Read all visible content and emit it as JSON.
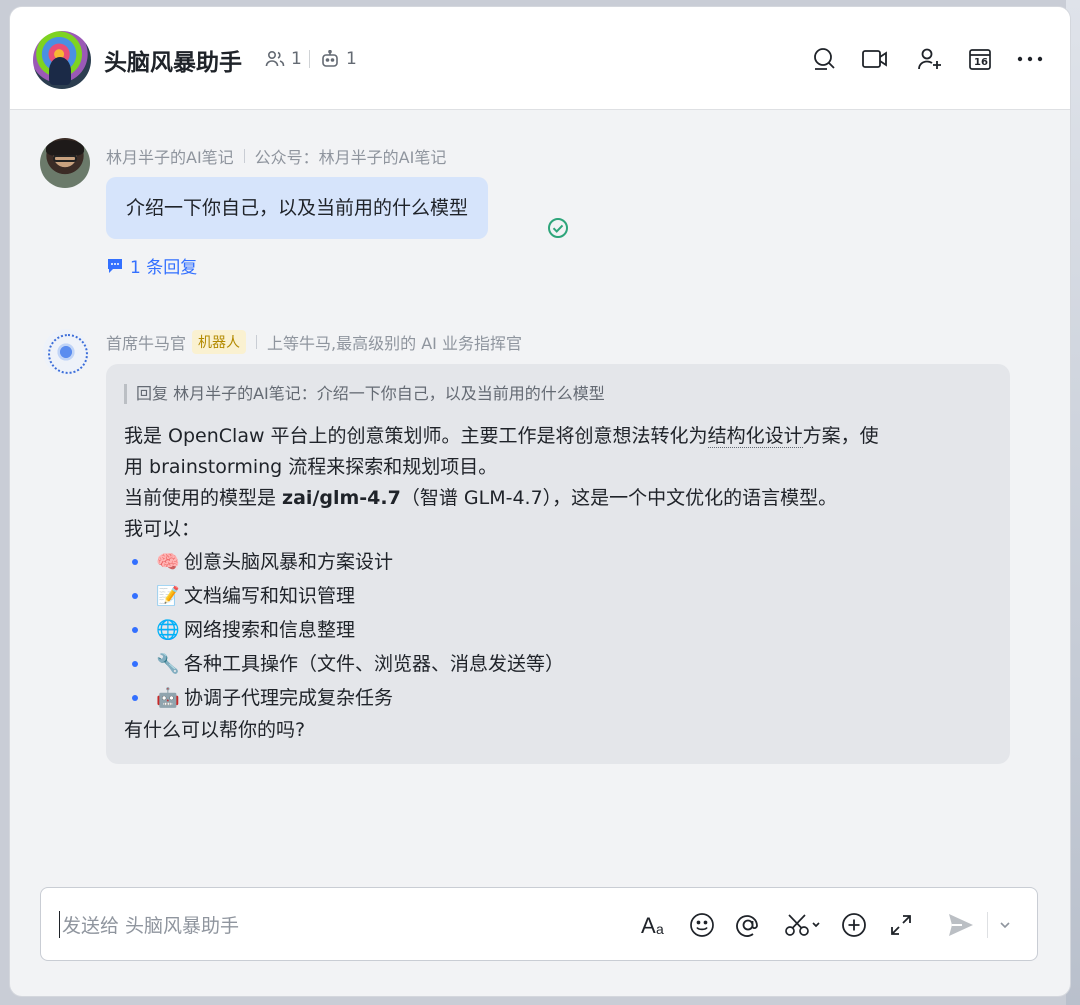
{
  "header": {
    "title": "头脑风暴助手",
    "member_count": "1",
    "bot_count": "1",
    "icons": [
      "search-icon",
      "video-call-icon",
      "add-member-icon",
      "calendar-icon",
      "more-icon"
    ],
    "calendar_day": "16"
  },
  "messages": {
    "user": {
      "name": "林月半子的AI笔记",
      "subtitle": "公众号：林月半子的AI笔记",
      "text": "介绍一下你自己，以及当前用的什么模型",
      "reply_count": "1 条回复"
    },
    "bot": {
      "name": "首席牛马官",
      "badge": "机器人",
      "subtitle": "上等牛马,最高级别的 AI 业务指挥官",
      "quote": "回复 林月半子的AI笔记：介绍一下你自己，以及当前用的什么模型",
      "line1a": "我是 OpenClaw 平台上的创意策划师。主要工作是将创意想法转化为",
      "line1b": "结构化设计",
      "line1c": "方案，使",
      "line2": "用 brainstorming 流程来探索和规划项目。",
      "line3a": "当前使用的模型是 ",
      "line3b": "zai/glm-4.7",
      "line3c": "（智谱 GLM-4.7），这是一个中文优化的语言模型。",
      "line4": "我可以：",
      "bullets": [
        {
          "emoji": "🧠",
          "text": "创意头脑风暴和方案设计"
        },
        {
          "emoji": "📝",
          "text": "文档编写和知识管理"
        },
        {
          "emoji": "🌐",
          "text": "网络搜索和信息整理"
        },
        {
          "emoji": "🔧",
          "text": "各种工具操作（文件、浏览器、消息发送等）"
        },
        {
          "emoji": "🤖",
          "text": "协调子代理完成复杂任务"
        }
      ],
      "closing": "有什么可以帮你的吗?"
    }
  },
  "composer": {
    "placeholder": "发送给 头脑风暴助手",
    "icons": [
      "text-format-icon",
      "emoji-icon",
      "mention-icon",
      "screenshot-icon",
      "add-icon",
      "expand-icon",
      "send-icon",
      "send-options-icon"
    ]
  }
}
